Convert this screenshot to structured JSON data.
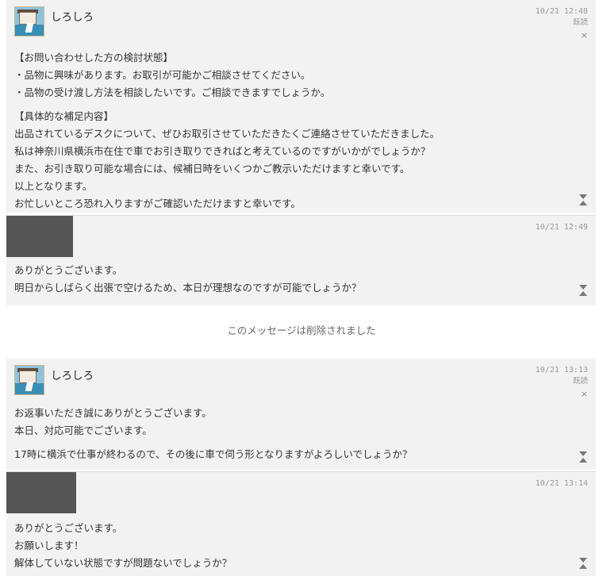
{
  "messages": [
    {
      "sender": "しろしろ",
      "time": "10/21 12:48",
      "read": "既読",
      "close": "×",
      "lines": [
        "【お問い合わせした方の検討状態】",
        "・品物に興味があります。お取引が可能かご相談させてください。",
        "・品物の受け渡し方法を相談したいです。ご相談できますでしょうか。",
        "【具体的な補足内容】",
        "出品されているデスクについて、ぜひお取引させていただきたくご連絡させていただきました。",
        "私は神奈川県横浜市在住で車でお引き取りできればと考えているのですがいかがでしょうか？",
        "また、お引き取り可能な場合には、候補日時をいくつかご教示いただけますと幸いです。",
        "以上となります。",
        "お忙しいところ恐れ入りますがご確認いただけますと幸いです。"
      ]
    },
    {
      "time": "10/21 12:49",
      "lines": [
        "ありがとうございます。",
        "明日からしばらく出張で空けるため、本日が理想なのですが可能でしょうか？"
      ]
    },
    {
      "sender": "しろしろ",
      "time": "10/21 13:13",
      "read": "既読",
      "close": "×",
      "lines": [
        "お返事いただき誠にありがとうございます。",
        "本日、対応可能でございます。",
        "17時に横浜で仕事が終わるので、その後に車で伺う形となりますがよろしいでしょうか？"
      ]
    },
    {
      "time": "10/21 13:14",
      "lines": [
        "ありがとうございます。",
        "お願いします！",
        "解体していない状態ですが問題ないでしょうか？"
      ]
    }
  ],
  "deleted_notice": "このメッセージは削除されました",
  "colors": {
    "message_bg": "#f2f2f2",
    "text": "#333333",
    "meta": "#999999",
    "hidden_avatar": "#555555"
  },
  "icons": {
    "expand": "triangle-expand-icon",
    "close": "close-icon"
  }
}
